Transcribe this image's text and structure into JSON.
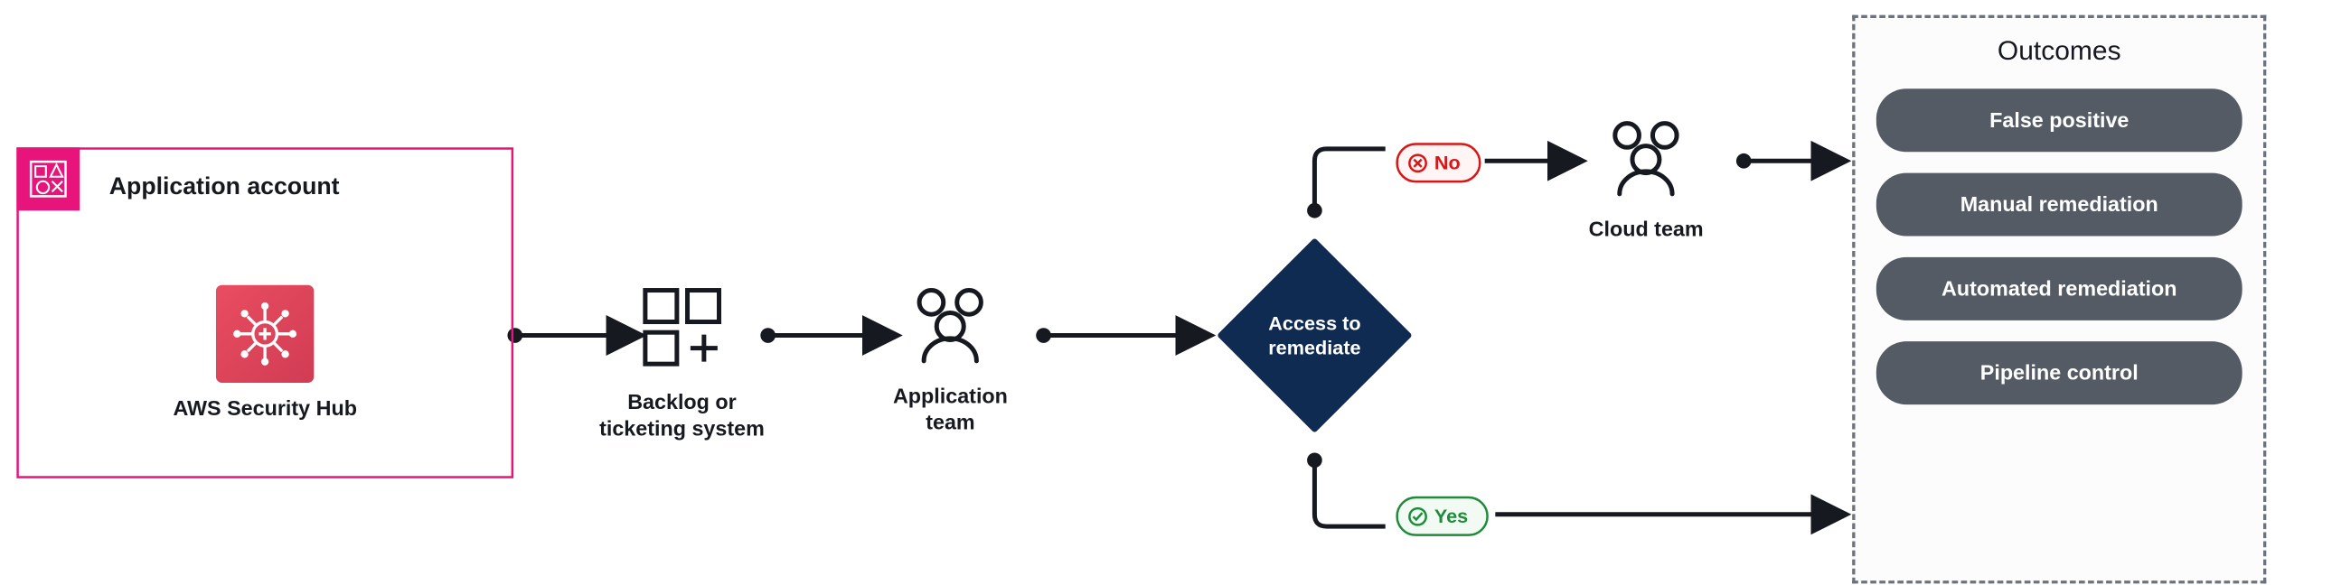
{
  "account": {
    "title": "Application account",
    "service_label": "AWS Security Hub"
  },
  "backlog": {
    "label": "Backlog or\nticketing system"
  },
  "app_team": {
    "label": "Application\nteam"
  },
  "decision": {
    "label": "Access to\nremediate"
  },
  "branches": {
    "no": "No",
    "yes": "Yes"
  },
  "cloud_team": {
    "label": "Cloud team"
  },
  "outcomes": {
    "title": "Outcomes",
    "items": [
      "False positive",
      "Manual remediation",
      "Automated remediation",
      "Pipeline control"
    ]
  }
}
